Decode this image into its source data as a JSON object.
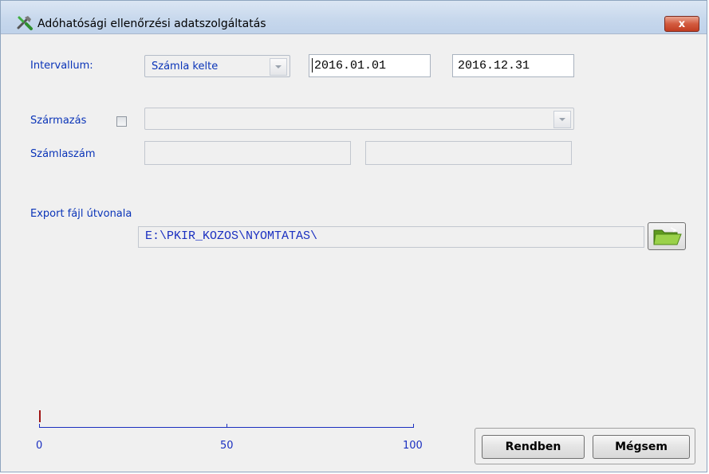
{
  "window": {
    "title": "Adóhatósági ellenőrzési adatszolgáltatás",
    "close_label": "x"
  },
  "interval": {
    "label": "Intervallum:",
    "type_value": "Számla kelte",
    "date_from": "2016.01.01",
    "date_to": "2016.12.31"
  },
  "origin": {
    "label": "Származás",
    "checked": false,
    "value": ""
  },
  "invoice_number": {
    "label": "Számlaszám",
    "from": "",
    "to": ""
  },
  "export": {
    "label": "Export fájl útvonala",
    "path": "E:\\PKIR_KOZOS\\NYOMTATAS\\",
    "browse_icon": "folder-open-icon"
  },
  "progress": {
    "value": 0,
    "min_label": "0",
    "mid_label": "50",
    "max_label": "100"
  },
  "buttons": {
    "ok": "Rendben",
    "cancel": "Mégsem"
  },
  "colors": {
    "label_blue": "#0a34b8",
    "scale_blue": "#1a2fc0",
    "progress_marker": "#a01515"
  }
}
